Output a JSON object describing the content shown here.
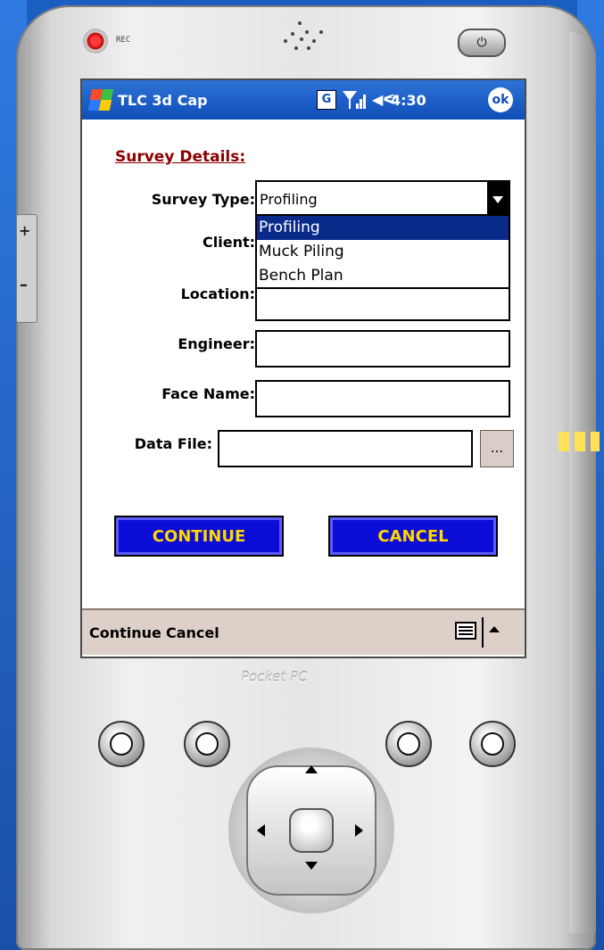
{
  "device": {
    "rec_label": "REC",
    "brand_label": "Pocket PC"
  },
  "titlebar": {
    "app_title": "TLC 3d Cap",
    "network_badge": "G",
    "time": "4:30",
    "ok_label": "ok"
  },
  "form": {
    "heading": "Survey Details:",
    "survey_type": {
      "label": "Survey Type:",
      "value": "Profiling"
    },
    "survey_type_options": [
      "Profiling",
      "Muck Piling",
      "Bench Plan"
    ],
    "client": {
      "label": "Client:",
      "value": ""
    },
    "location": {
      "label": "Location:",
      "value": ""
    },
    "engineer": {
      "label": "Engineer:",
      "value": ""
    },
    "face_name": {
      "label": "Face Name:",
      "value": ""
    },
    "data_file": {
      "label": "Data File:",
      "value": ""
    },
    "browse_label": "...",
    "continue_label": "CONTINUE",
    "cancel_label": "CANCEL"
  },
  "menubar": {
    "continue": "Continue",
    "cancel": "Cancel"
  },
  "colors": {
    "titlebar": "#1a5fd0",
    "heading": "#8b0000",
    "button_bg": "#0c0cd8",
    "button_text": "#ffd700",
    "menubar": "#ddd0c8",
    "selected_option": "#0a2a8a"
  },
  "icons": [
    "windows-start-icon",
    "signal-icon",
    "volume-icon",
    "keyboard-icon",
    "power-icon"
  ]
}
